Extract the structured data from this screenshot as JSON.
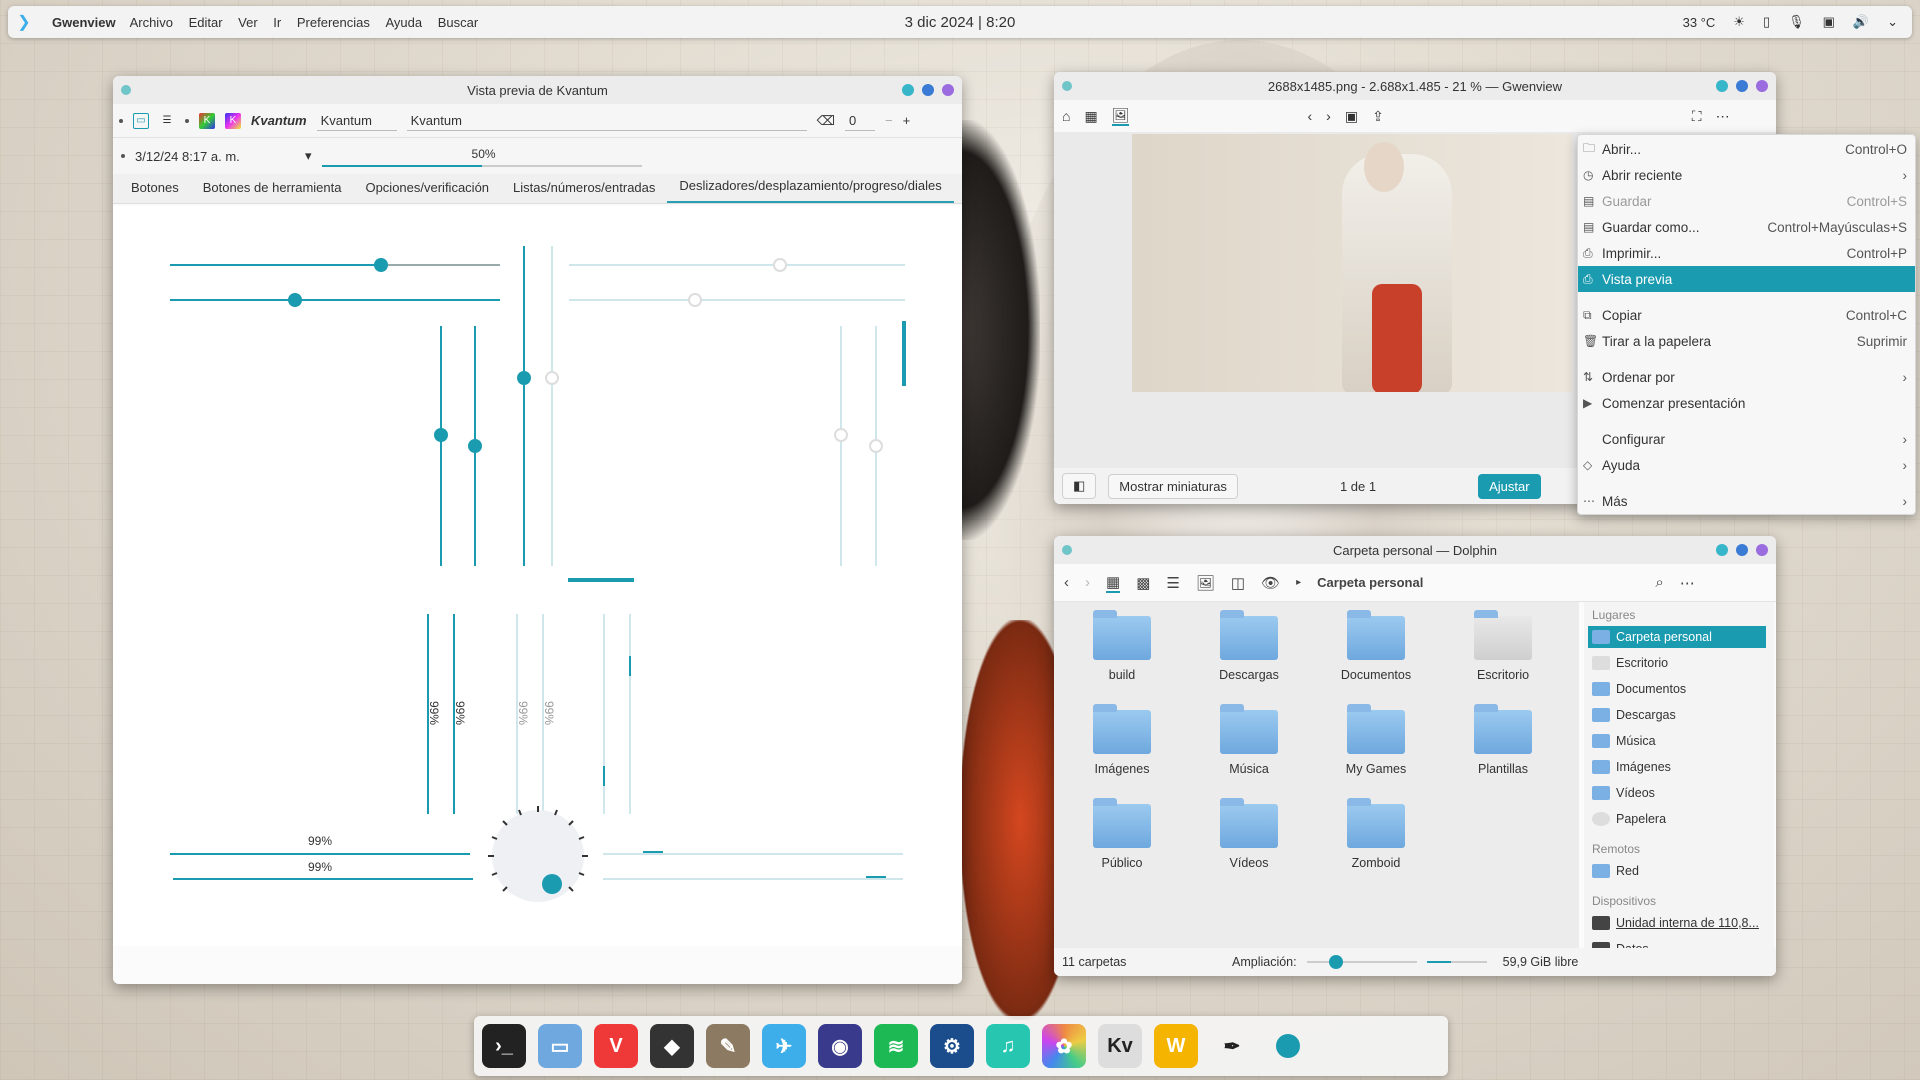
{
  "topbar": {
    "app_name": "Gwenview",
    "menu": [
      "Archivo",
      "Editar",
      "Ver",
      "Ir",
      "Preferencias",
      "Ayuda",
      "Buscar"
    ],
    "clock": "3 dic 2024 | 8:20",
    "temperature": "33 °C"
  },
  "kvantum": {
    "title": "Vista previa de Kvantum",
    "toolbar_label_italic": "Kvantum",
    "combo_value": "Kvantum",
    "field_value": "Kvantum",
    "spin_value": "0",
    "spin_minus": "−",
    "spin_plus": "+",
    "datetime": "3/12/24 8:17 a. m.",
    "progress_text": "50%",
    "tabs": [
      "Botones",
      "Botones de herramienta",
      "Opciones/verificación",
      "Listas/números/entradas",
      "Deslizadores/desplazamiento/progreso/diales"
    ],
    "vprog_labels": [
      "99%",
      "99%",
      "99%",
      "99%"
    ],
    "hprog_labels": [
      "99%",
      "99%"
    ]
  },
  "gwenview": {
    "title": "2688x1485.png - 2.688x1.485 - 21 % — Gwenview",
    "show_thumbs": "Mostrar miniaturas",
    "page_count": "1 de 1",
    "fit_button": "Ajustar"
  },
  "context_menu": {
    "items": [
      {
        "label": "Abrir...",
        "shortcut": "Control+O",
        "icon": "folder-open-icon"
      },
      {
        "label": "Abrir reciente",
        "shortcut": "",
        "icon": "recent-icon",
        "submenu": true
      },
      {
        "label": "Guardar",
        "shortcut": "Control+S",
        "icon": "save-icon",
        "disabled": true
      },
      {
        "label": "Guardar como...",
        "shortcut": "Control+Mayúsculas+S",
        "icon": "save-as-icon"
      },
      {
        "label": "Imprimir...",
        "shortcut": "Control+P",
        "icon": "print-icon"
      },
      {
        "label": "Vista previa",
        "shortcut": "",
        "icon": "print-preview-icon",
        "highlighted": true
      },
      {
        "label": "Copiar",
        "shortcut": "Control+C",
        "icon": "copy-icon"
      },
      {
        "label": "Tirar a la papelera",
        "shortcut": "Suprimir",
        "icon": "trash-icon"
      },
      {
        "label": "Ordenar por",
        "shortcut": "",
        "icon": "sort-icon",
        "submenu": true
      },
      {
        "label": "Comenzar presentación",
        "shortcut": "",
        "icon": "play-icon"
      },
      {
        "label": "Configurar",
        "shortcut": "",
        "icon": "configure-icon",
        "submenu": true
      },
      {
        "label": "Ayuda",
        "shortcut": "",
        "icon": "help-icon",
        "submenu": true
      },
      {
        "label": "Más",
        "shortcut": "",
        "icon": "more-icon",
        "submenu": true
      }
    ]
  },
  "dolphin": {
    "title": "Carpeta personal — Dolphin",
    "breadcrumb": "Carpeta personal",
    "folders": [
      "build",
      "Descargas",
      "Documentos",
      "Escritorio",
      "Imágenes",
      "Música",
      "My Games",
      "Plantillas",
      "Público",
      "Vídeos",
      "Zomboid"
    ],
    "sidebar": {
      "places_header": "Lugares",
      "places": [
        "Carpeta personal",
        "Escritorio",
        "Documentos",
        "Descargas",
        "Música",
        "Imágenes",
        "Vídeos",
        "Papelera"
      ],
      "remote_header": "Remotos",
      "remote": [
        "Red"
      ],
      "devices_header": "Dispositivos",
      "devices": [
        "Unidad interna de 110,8...",
        "Datos"
      ]
    },
    "status_count": "11 carpetas",
    "zoom_label": "Ampliación:",
    "free_space": "59,9 GiB libre"
  },
  "dock": {
    "apps": [
      "terminal-icon",
      "files-icon",
      "vivaldi-icon",
      "inkscape-icon",
      "gimp-icon",
      "kdeconnect-icon",
      "podcast-icon",
      "spotify-icon",
      "steam-icon",
      "music-icon",
      "photos-icon",
      "kvantum-icon",
      "wps-icon",
      "color-picker-icon",
      "circle-icon"
    ],
    "colors": {
      "accent": "#1b9bb0",
      "spotify": "#1db954",
      "vivaldi": "#ef3939",
      "steam": "#1b4d8c"
    }
  }
}
